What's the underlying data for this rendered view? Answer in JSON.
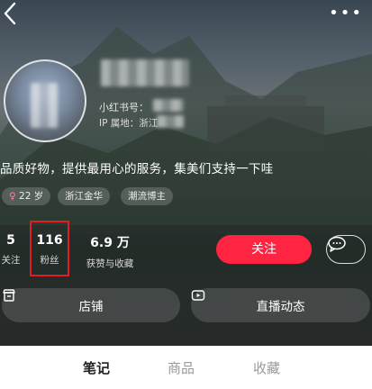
{
  "profile": {
    "redbook_id_label": "小红书号：",
    "ip_label": "IP 属地：浙江",
    "bio": "品质好物，提供最用心的服务，集美们支持一下哇",
    "tags": [
      "22 岁",
      "浙江金华",
      "潮流博主"
    ]
  },
  "stats": [
    {
      "value": "5",
      "label": "关注"
    },
    {
      "value": "116",
      "label": "粉丝"
    },
    {
      "value": "6.9 万",
      "label": "获赞与收藏"
    }
  ],
  "buttons": {
    "follow": "关注",
    "chat_icon": "chat-bubble-icon"
  },
  "actions": [
    {
      "label": "店铺",
      "icon": "store-icon"
    },
    {
      "label": "直播动态",
      "icon": "live-icon"
    }
  ],
  "tabs": [
    {
      "label": "笔记",
      "active": true
    },
    {
      "label": "商品",
      "active": false
    },
    {
      "label": "收藏",
      "active": false
    }
  ],
  "colors": {
    "accent": "#ff2442",
    "highlight_box": "#e0201e",
    "inactive_tab": "#999999"
  }
}
